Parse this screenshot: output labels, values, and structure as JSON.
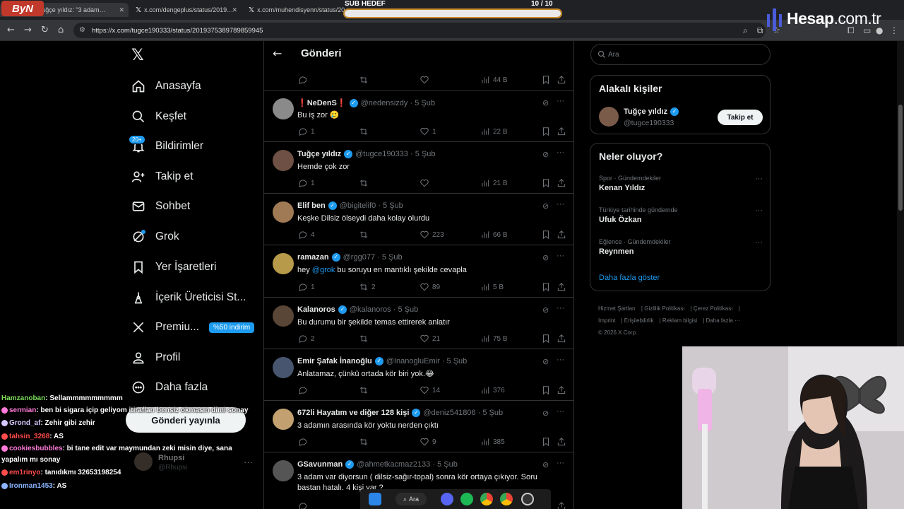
{
  "browser": {
    "tabs": [
      {
        "label": "(30) X'te Tuğçe yıldız: \"3 adam…",
        "active": true
      },
      {
        "label": "x.com/dengeplus/status/2019…",
        "active": false
      },
      {
        "label": "x.com/muhendisyenn/status/20…",
        "active": false
      }
    ],
    "url": "https://x.com/tugce190333/status/2019375389789859945"
  },
  "overlay": {
    "streamer_logo": "ByN",
    "sub_goal_label": "SUB HEDEF",
    "sub_goal_count": "10  / 10",
    "sub_goal_progress": 1.0,
    "brand_left": "Hesap",
    "brand_right": ".com.tr"
  },
  "nav": {
    "items": [
      {
        "label": "Anasayfa",
        "icon": "home-icon"
      },
      {
        "label": "Keşfet",
        "icon": "search-icon"
      },
      {
        "label": "Bildirimler",
        "icon": "bell-icon",
        "badge": "20+"
      },
      {
        "label": "Takip et",
        "icon": "person-plus-icon"
      },
      {
        "label": "Sohbet",
        "icon": "mail-icon"
      },
      {
        "label": "Grok",
        "icon": "grok-icon"
      },
      {
        "label": "Yer İşaretleri",
        "icon": "bookmark-icon"
      },
      {
        "label": "İçerik Üreticisi St...",
        "icon": "creator-icon"
      },
      {
        "label": "Premiu...",
        "icon": "x-icon",
        "promo": "%50 indirim"
      },
      {
        "label": "Profil",
        "icon": "profile-icon"
      },
      {
        "label": "Daha fazla",
        "icon": "more-circle-icon"
      }
    ],
    "post_button": "Gönderi yayınla",
    "account": {
      "name": "Rhupsi",
      "handle": "@Rhupsi"
    }
  },
  "main": {
    "title": "Gönderi",
    "top_actions": {
      "views": "44 B"
    },
    "tweets": [
      {
        "name": "NeDenS",
        "red_marks": true,
        "handle": "@nedensizdy",
        "time": "5 Şub",
        "text": "Bu iş zor 🥲",
        "replies": "1",
        "retweets": "",
        "likes": "1",
        "views": "22 B",
        "avatar_color": "#8a8a8a"
      },
      {
        "name": "Tuğçe yıldız",
        "handle": "@tugce190333",
        "time": "5 Şub",
        "text": "Hemde çok zor",
        "replies": "1",
        "retweets": "",
        "likes": "",
        "views": "21 B",
        "avatar_color": "#6e5044"
      },
      {
        "name": "Elif ben",
        "handle": "@bigitelif0",
        "time": "5 Şub",
        "text": "Keşke Dilsiz ölseydi daha kolay olurdu",
        "replies": "4",
        "retweets": "",
        "likes": "223",
        "views": "66 B",
        "avatar_color": "#a07a55"
      },
      {
        "name": "ramazan",
        "handle": "@rgg077",
        "time": "5 Şub",
        "text_pre": "hey ",
        "text_link": "@grok",
        "text": " bu soruyu en mantıklı şekilde cevapla",
        "replies": "1",
        "retweets": "2",
        "likes": "89",
        "views": "5 B",
        "avatar_color": "#b79a4a"
      },
      {
        "name": "Kalanoros",
        "handle": "@kalanoros",
        "time": "5 Şub",
        "text": "Bu durumu bir şekilde temas ettirerek anlatır",
        "replies": "2",
        "retweets": "",
        "likes": "21",
        "views": "75 B",
        "avatar_color": "#5a4636"
      },
      {
        "name": "Emir Şafak İnanoğlu",
        "handle": "@InanogluEmir",
        "time": "5 Şub",
        "text": "Anlatamaz, çünkü ortada kör biri yok.😂",
        "replies": "",
        "retweets": "",
        "likes": "14",
        "views": "376",
        "avatar_color": "#47566e"
      },
      {
        "name": "672li Hayatım ve diğer 128 kişi",
        "handle": "@deniz541806",
        "time": "5 Şub",
        "text": "3 adamın arasında kör yoktu nerden çıktı",
        "replies": "",
        "retweets": "",
        "likes": "9",
        "views": "385",
        "avatar_color": "#c2a070"
      },
      {
        "name": "GSavunman",
        "handle": "@ahmetkacmaz2133",
        "time": "5 Şub",
        "text": "3 adam var diyorsun ( dilsiz-sağır-topal) sonra kör ortaya çıkıyor. Soru bastan hatalı. 4 kişi var ?",
        "replies": "",
        "retweets": "",
        "likes": "",
        "views": "",
        "avatar_color": "#555555"
      }
    ]
  },
  "sidebar": {
    "search_placeholder": "Ara",
    "related": {
      "title": "Alakalı kişiler",
      "name": "Tuğçe yıldız",
      "handle": "@tugce190333",
      "follow": "Takip et"
    },
    "trends": {
      "title": "Neler oluyor?",
      "items": [
        {
          "context": "Spor · Gündemdekiler",
          "topic": "Kenan Yıldız"
        },
        {
          "context": "Türkiye tarihinde gündemde",
          "topic": "Ufuk Özkan"
        },
        {
          "context": "Eğlence · Gündemdekiler",
          "topic": "Reynmen"
        }
      ],
      "show_more": "Daha fazla göster"
    },
    "footer": [
      "Hizmet Şartları",
      "Gizlilik Politikası",
      "Çerez Politikası",
      "Imprint",
      "Erişilebilirlik",
      "Reklam bilgisi",
      "Daha fazla ···",
      "© 2026 X Corp."
    ]
  },
  "chat": [
    {
      "user": "Hamzanoban",
      "msg": ": Sellammmmmmmmm",
      "color": "#7ddc5a"
    },
    {
      "user": "sermian",
      "msg": ": ben bi sigara içip geliyom itirafları bensiz okmasın dimi sonay",
      "color": "#ff7ad9"
    },
    {
      "user": "Grond_af",
      "msg": ": Zehir gibi zehir",
      "color": "#d6c7ff"
    },
    {
      "user": "tahsin_3268",
      "msg": ": AS",
      "color": "#ff4b4b"
    },
    {
      "user": "cookiesbubbles",
      "msg": ": bi tane edit var maymundan zeki misin diye, sana yapalım mı sonay",
      "color": "#ff7ad9"
    },
    {
      "user": "em1rinyo",
      "msg": ": tanıdıkmı 32653198254",
      "color": "#ff4b4b"
    },
    {
      "user": "Ironman1453",
      "msg": ": AS",
      "color": "#8ab4ff"
    }
  ],
  "taskbar": {
    "search_label": "Ara"
  }
}
